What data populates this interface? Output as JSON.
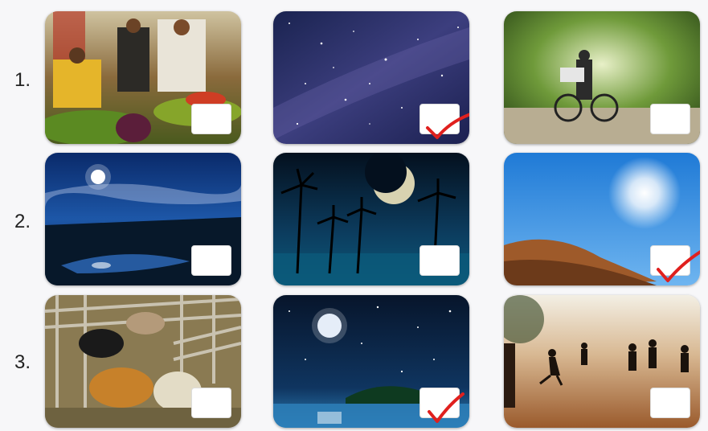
{
  "rows": [
    {
      "label": "1.",
      "cards": [
        {
          "icon": "market-scene-photo",
          "checked": false
        },
        {
          "icon": "starry-night-sky-photo",
          "checked": true
        },
        {
          "icon": "cyclist-forest-road-photo",
          "checked": false
        }
      ]
    },
    {
      "label": "2.",
      "cards": [
        {
          "icon": "moonlit-river-landscape-photo",
          "checked": false
        },
        {
          "icon": "crescent-moon-palm-trees-photo",
          "checked": false
        },
        {
          "icon": "bright-sun-blue-sky-photo",
          "checked": true
        }
      ]
    },
    {
      "label": "3.",
      "cards": [
        {
          "icon": "cattle-pen-photo",
          "checked": false
        },
        {
          "icon": "full-moon-island-night-photo",
          "checked": true
        },
        {
          "icon": "boys-playing-football-dusk-photo",
          "checked": false
        }
      ]
    }
  ],
  "colors": {
    "check_mark": "#e0201e",
    "background": "#f7f7f9"
  }
}
